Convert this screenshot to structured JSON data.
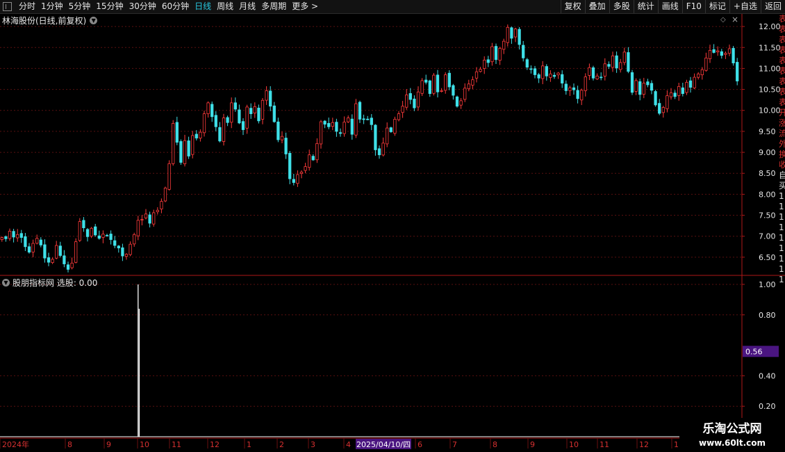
{
  "toolbar": {
    "periods": [
      {
        "label": "分时",
        "active": false
      },
      {
        "label": "1分钟",
        "active": false
      },
      {
        "label": "5分钟",
        "active": false
      },
      {
        "label": "15分钟",
        "active": false
      },
      {
        "label": "30分钟",
        "active": false
      },
      {
        "label": "60分钟",
        "active": false
      },
      {
        "label": "日线",
        "active": true
      },
      {
        "label": "周线",
        "active": false
      },
      {
        "label": "月线",
        "active": false
      },
      {
        "label": "多周期",
        "active": false
      },
      {
        "label": "更多 >",
        "active": false
      }
    ],
    "right_buttons": [
      "复权",
      "叠加",
      "多股",
      "统计",
      "画线",
      "F10",
      "标记",
      "+自选",
      "返回"
    ]
  },
  "main_panel": {
    "title": "林海股份(日线,前复权)",
    "y_ticks": [
      "12.00",
      "11.50",
      "11.00",
      "10.50",
      "10.00",
      "9.50",
      "9.00",
      "8.50",
      "8.00",
      "7.50",
      "7.00",
      "6.50"
    ]
  },
  "indicator_panel": {
    "title": "股朋指标网 选股: 0.00",
    "y_ticks": [
      "1.00",
      "0.80",
      "0.56",
      "0.40",
      "0.20"
    ],
    "cursor_label": "0.56"
  },
  "x_axis": {
    "labels": [
      "2024年",
      "8",
      "9",
      "10",
      "11",
      "12",
      "1",
      "2",
      "3",
      "4",
      "2025/04/10/四",
      "6",
      "7",
      "8",
      "9",
      "10",
      "11",
      "12",
      "1"
    ]
  },
  "watermark": {
    "line1": "乐淘公式网",
    "line2": "www.60lt.com"
  },
  "side_strip_chars": [
    "表",
    "表",
    "表",
    "表",
    "表",
    "表",
    "表",
    "表",
    "表",
    "开",
    "涨",
    "流",
    "外",
    "换",
    "收",
    "自",
    "买",
    "1",
    "1",
    "1",
    "1",
    "1",
    "1",
    "1",
    "1",
    "1"
  ],
  "colors": {
    "up": "#ff3b3b",
    "down": "#3fe0e8",
    "grid": "#5a1010",
    "axis": "#b01818",
    "label": "#e6e6e6",
    "highlight": "#4a1580"
  },
  "chart_data": {
    "type": "candlestick",
    "ylim": [
      6.1,
      12.3
    ],
    "indicator_ylim": [
      0,
      1.05
    ],
    "indicator_signal": {
      "bar_index": 35,
      "value": 1.0
    },
    "closes": [
      6.97,
      6.94,
      7.12,
      6.98,
      7.04,
      6.97,
      6.75,
      6.62,
      6.83,
      6.95,
      6.79,
      6.48,
      6.38,
      6.45,
      6.78,
      6.54,
      6.34,
      6.21,
      6.36,
      6.87,
      7.35,
      7.2,
      6.99,
      7.19,
      7.03,
      6.95,
      7.05,
      7.02,
      6.92,
      6.78,
      6.72,
      6.53,
      6.57,
      6.81,
      7.04,
      7.38,
      7.4,
      7.53,
      7.31,
      7.56,
      7.62,
      7.83,
      8.15,
      8.73,
      9.69,
      9.24,
      8.76,
      9.28,
      8.91,
      9.4,
      9.34,
      9.48,
      9.92,
      10.18,
      9.85,
      9.61,
      9.27,
      9.82,
      9.71,
      10.18,
      10.03,
      9.7,
      9.54,
      10.08,
      9.92,
      10.09,
      9.75,
      10.24,
      10.47,
      10.1,
      9.73,
      9.3,
      9.38,
      8.96,
      8.37,
      8.28,
      8.47,
      8.53,
      8.66,
      8.94,
      8.82,
      9.21,
      9.73,
      9.67,
      9.61,
      9.71,
      9.5,
      9.45,
      9.72,
      9.82,
      9.43,
      10.16,
      9.79,
      9.78,
      9.79,
      9.66,
      9.06,
      8.94,
      9.22,
      9.58,
      9.49,
      9.79,
      9.92,
      10.1,
      10.37,
      10.26,
      10.06,
      10.44,
      10.71,
      10.67,
      10.4,
      10.84,
      10.44,
      10.47,
      10.85,
      10.56,
      10.36,
      10.1,
      10.23,
      10.53,
      10.63,
      10.73,
      10.92,
      10.98,
      11.2,
      11.14,
      11.52,
      11.21,
      11.48,
      11.65,
      11.98,
      11.72,
      11.94,
      11.57,
      11.25,
      11.03,
      10.99,
      10.85,
      10.77,
      11.06,
      10.82,
      10.87,
      10.81,
      10.89,
      10.65,
      10.47,
      10.54,
      10.49,
      10.28,
      10.48,
      10.8,
      11.02,
      10.77,
      10.82,
      10.78,
      11.11,
      11.05,
      11.3,
      11.01,
      11.14,
      11.39,
      10.93,
      10.43,
      10.71,
      10.38,
      10.65,
      10.61,
      10.48,
      10.13,
      9.93,
      10.07,
      10.35,
      10.42,
      10.33,
      10.57,
      10.4,
      10.67,
      10.55,
      10.79,
      10.87,
      10.97,
      11.25,
      11.43,
      11.38,
      11.42,
      11.31,
      11.36,
      11.47,
      11.13,
      10.7
    ]
  }
}
